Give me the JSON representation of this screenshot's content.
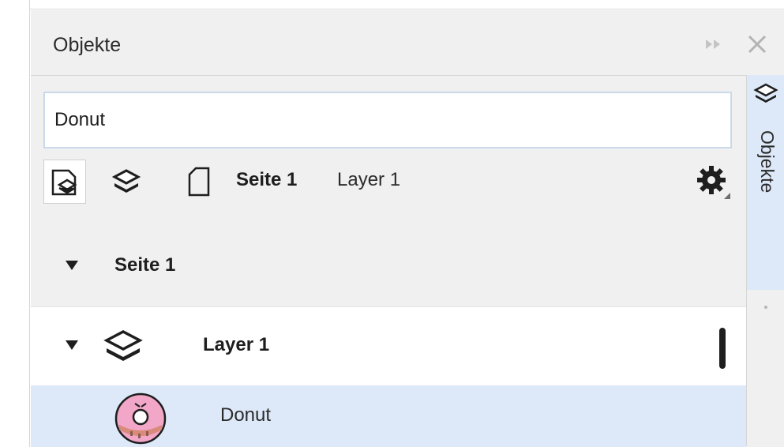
{
  "docker": {
    "title": "Objekte",
    "collapse_icon": "double-chevron-right-icon",
    "close_icon": "close-icon"
  },
  "search": {
    "value": "Donut"
  },
  "toolbar": {
    "buttons": [
      "page-layer-view-icon",
      "layer-view-icon",
      "page-view-icon"
    ],
    "breadcrumb_page": "Seite 1",
    "breadcrumb_layer": "Layer 1",
    "options_icon": "gear-icon"
  },
  "tree": {
    "page": {
      "label": "Seite 1"
    },
    "layer": {
      "label": "Layer 1",
      "color": "#1e1e1e"
    },
    "object": {
      "label": "Donut",
      "thumbnail": "donut-icon"
    }
  },
  "side_tab": {
    "label": "Objekte",
    "icon": "layers-icon"
  },
  "colors": {
    "panel_bg": "#f0f0f0",
    "selection": "#dde9f8",
    "search_border": "#c9d9ea",
    "donut_frosting": "#f2a7c8"
  }
}
